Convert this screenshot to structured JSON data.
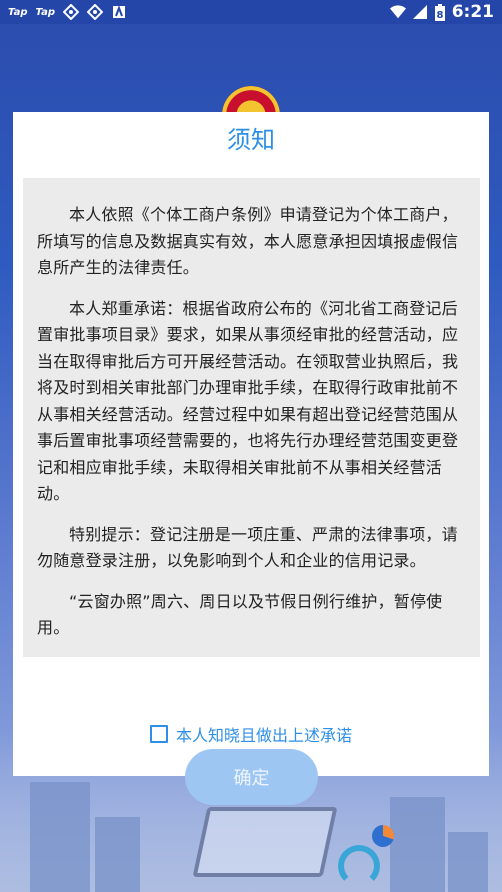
{
  "status_bar": {
    "left_labels": [
      "Tap",
      "Tap"
    ],
    "time": "6:21",
    "battery_level": "8"
  },
  "dialog": {
    "title": "须知",
    "paragraphs": [
      "本人依照《个体工商户条例》申请登记为个体工商户，所填写的信息及数据真实有效，本人愿意承担因填报虚假信息所产生的法律责任。",
      "本人郑重承诺：根据省政府公布的《河北省工商登记后置审批事项目录》要求，如果从事须经审批的经营活动，应当在取得审批后方可开展经营活动。在领取营业执照后，我将及时到相关审批部门办理审批手续，在取得行政审批前不从事相关经营活动。经营过程中如果有超出登记经营范围从事后置审批事项经营需要的，也将先行办理经营范围变更登记和相应审批手续，未取得相关审批前不从事相关经营活动。",
      "特别提示：登记注册是一项庄重、严肃的法律事项，请勿随意登录注册，以免影响到个人和企业的信用记录。",
      "“云窗办照”周六、周日以及节假日例行维护，暂停使用。"
    ],
    "agree_label": "本人知晓且做出上述承诺",
    "agree_checked": false
  },
  "confirm_button_label": "确定",
  "colors": {
    "accent": "#2e8fe8",
    "status_bar": "#2346a8",
    "button_disabled": "#9ec6f3"
  }
}
